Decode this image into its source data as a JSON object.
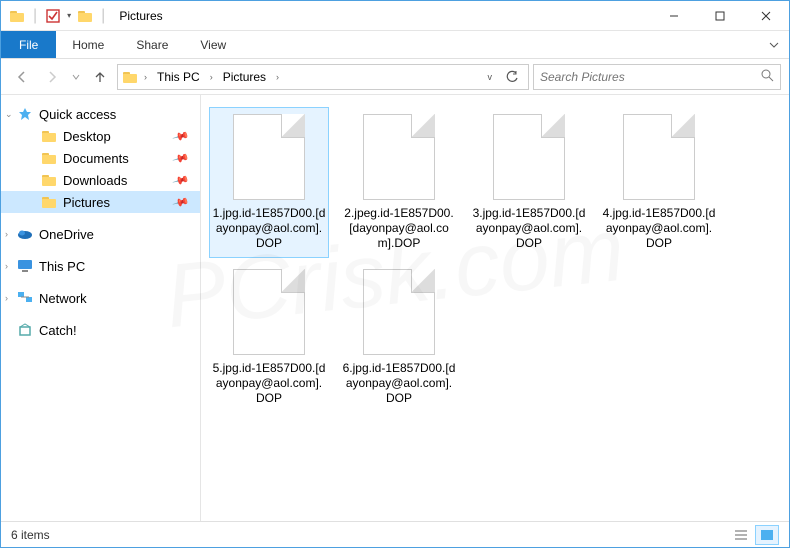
{
  "window": {
    "title": "Pictures"
  },
  "ribbon": {
    "file": "File",
    "tabs": [
      "Home",
      "Share",
      "View"
    ]
  },
  "breadcrumb": {
    "segments": [
      "This PC",
      "Pictures"
    ]
  },
  "search": {
    "placeholder": "Search Pictures"
  },
  "sidebar": {
    "quick_access": {
      "label": "Quick access",
      "items": [
        {
          "label": "Desktop",
          "pinned": true
        },
        {
          "label": "Documents",
          "pinned": true
        },
        {
          "label": "Downloads",
          "pinned": true
        },
        {
          "label": "Pictures",
          "pinned": true,
          "selected": true
        }
      ]
    },
    "onedrive": "OneDrive",
    "thispc": "This PC",
    "network": "Network",
    "catch": "Catch!"
  },
  "files": [
    {
      "name": "1.jpg.id-1E857D00.[dayonpay@aol.com].DOP",
      "selected": true
    },
    {
      "name": "2.jpeg.id-1E857D00.[dayonpay@aol.com].DOP"
    },
    {
      "name": "3.jpg.id-1E857D00.[dayonpay@aol.com].DOP"
    },
    {
      "name": "4.jpg.id-1E857D00.[dayonpay@aol.com].DOP"
    },
    {
      "name": "5.jpg.id-1E857D00.[dayonpay@aol.com].DOP"
    },
    {
      "name": "6.jpg.id-1E857D00.[dayonpay@aol.com].DOP"
    }
  ],
  "status": {
    "count_label": "6 items"
  }
}
